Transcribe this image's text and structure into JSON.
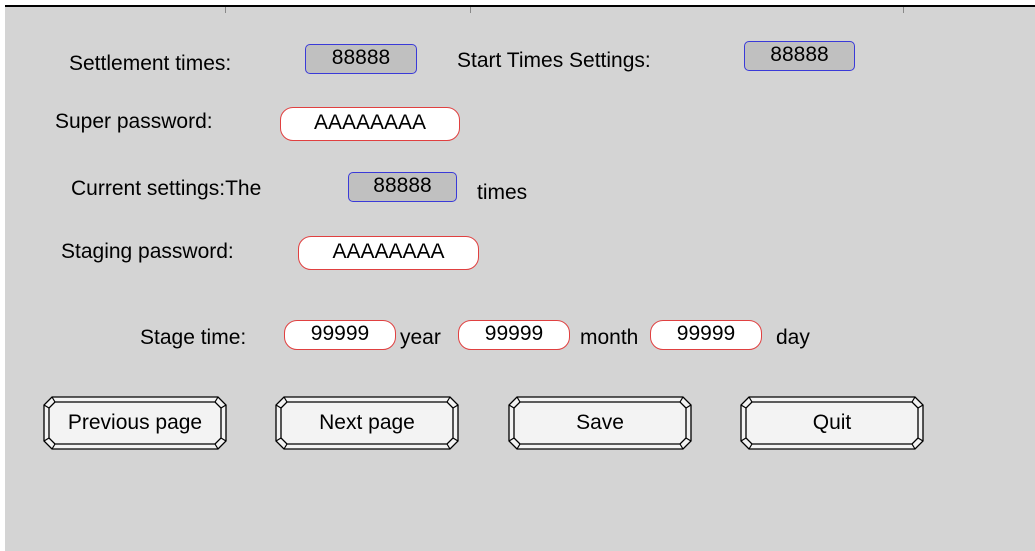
{
  "settlement": {
    "label": "Settlement times:",
    "value": "88888"
  },
  "start_times": {
    "label": "Start Times Settings:",
    "value": "88888"
  },
  "super_password": {
    "label": "Super password:",
    "value": "AAAAAAAA"
  },
  "current": {
    "label": "Current settings:The",
    "value": "88888",
    "suffix": "times"
  },
  "staging_password": {
    "label": "Staging password:",
    "value": "AAAAAAAA"
  },
  "stage_time": {
    "label": "Stage time:",
    "year_value": "99999",
    "year_label": "year",
    "month_value": "99999",
    "month_label": "month",
    "day_value": "99999",
    "day_label": "day"
  },
  "buttons": {
    "previous": "Previous page",
    "next": "Next page",
    "save": "Save",
    "quit": "Quit"
  },
  "colors": {
    "panel": "#d4d4d4",
    "numeric_border": "#3a3ad8",
    "text_border": "#e04040"
  }
}
